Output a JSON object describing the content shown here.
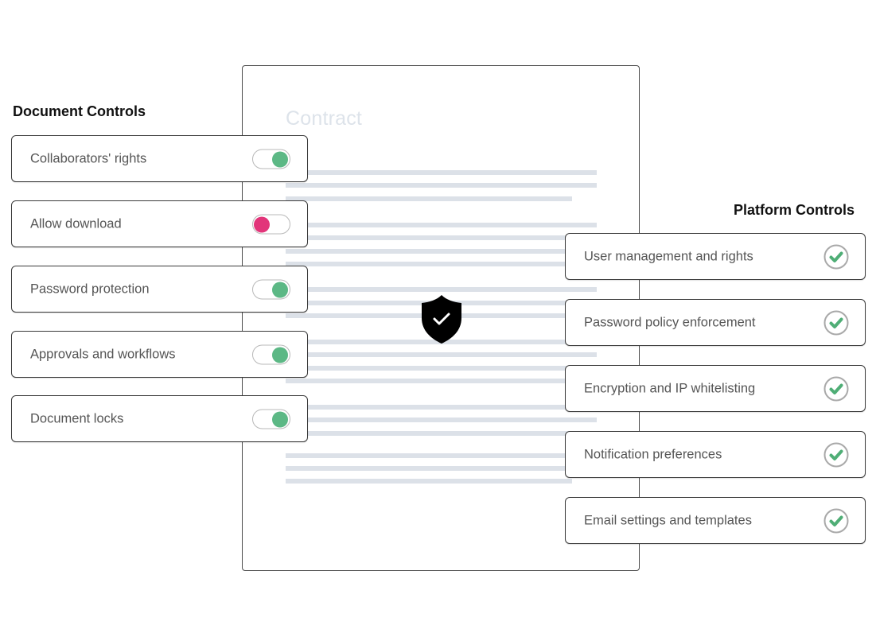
{
  "document": {
    "title": "Contract",
    "line_color": "#dce1e8",
    "badge_icon": "shield-check-icon"
  },
  "document_controls": {
    "title": "Document Controls",
    "items": [
      {
        "label": "Collaborators' rights",
        "enabled": true
      },
      {
        "label": "Allow download",
        "enabled": false
      },
      {
        "label": "Password protection",
        "enabled": true
      },
      {
        "label": "Approvals and workflows",
        "enabled": true
      },
      {
        "label": "Document locks",
        "enabled": true
      }
    ]
  },
  "platform_controls": {
    "title": "Platform Controls",
    "items": [
      {
        "label": "User management and rights",
        "status": "check-circle-icon"
      },
      {
        "label": "Password policy enforcement",
        "status": "check-circle-icon"
      },
      {
        "label": "Encryption and IP whitelisting",
        "status": "check-circle-icon"
      },
      {
        "label": "Notification preferences",
        "status": "check-circle-icon"
      },
      {
        "label": "Email settings and templates",
        "status": "check-circle-icon"
      }
    ]
  },
  "colors": {
    "on": "#5cb885",
    "off": "#e2357a",
    "check": "#4fae76",
    "check_ring": "#a9a9a9"
  }
}
